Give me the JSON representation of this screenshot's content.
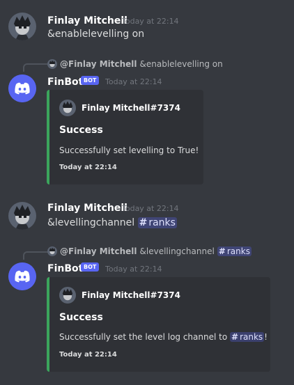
{
  "messages": {
    "m1": {
      "username": "Finlay Mitchell",
      "timestamp": "Today at 22:14",
      "content": "&enablelevelling on"
    },
    "m2": {
      "reply": {
        "name": "@Finlay Mitchell",
        "text": "&enablelevelling on"
      },
      "username": "FinBot",
      "badge": "BOT",
      "timestamp": "Today at 22:14",
      "embed": {
        "author": "Finlay Mitchell#7374",
        "title": "Success",
        "description": "Successfully set levelling to True!",
        "footer": "Today at 22:14",
        "color": "#3ba55c"
      }
    },
    "m3": {
      "username": "Finlay Mitchell",
      "timestamp": "Today at 22:14",
      "content_prefix": "&levellingchannel",
      "channel": "ranks"
    },
    "m4": {
      "reply": {
        "name": "@Finlay Mitchell",
        "text": "&levellingchannel",
        "channel": "ranks"
      },
      "username": "FinBot",
      "badge": "BOT",
      "timestamp": "Today at 22:14",
      "embed": {
        "author": "Finlay Mitchell#7374",
        "title": "Success",
        "description_prefix": "Successfully set the level log channel to",
        "channel": "ranks",
        "description_suffix": "!",
        "footer": "Today at 22:14",
        "color": "#3ba55c"
      }
    }
  },
  "colors": {
    "background": "#36393f",
    "embed_bg": "#2f3136",
    "embed_accent": "#3ba55c",
    "bot_badge": "#5865f2",
    "blurple": "#5865f2"
  },
  "icons": {
    "user_avatar": "user-avatar-icon",
    "bot_avatar": "discord-logo-icon",
    "channel": "hash-icon"
  }
}
